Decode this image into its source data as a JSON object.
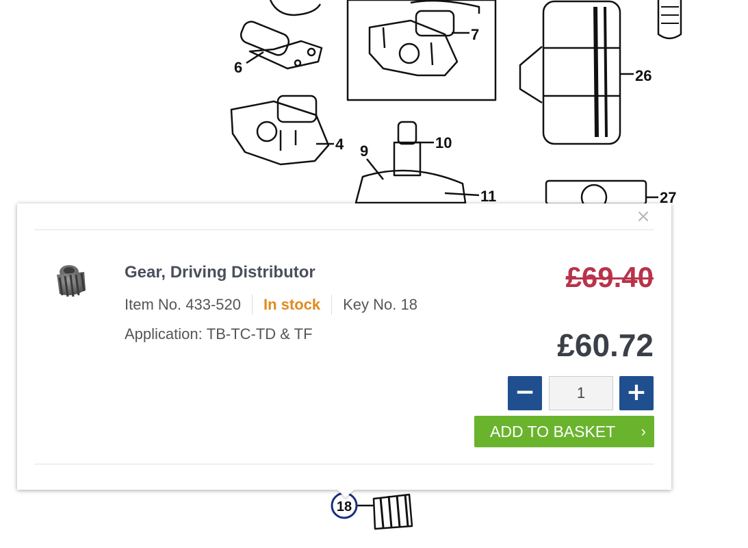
{
  "diagram": {
    "callouts": [
      "6",
      "7",
      "26",
      "4",
      "10",
      "9",
      "11",
      "27",
      "18"
    ]
  },
  "popup": {
    "close_icon": "×",
    "product": {
      "thumbnail_icon": "gear-thumbnail",
      "title": "Gear, Driving Distributor",
      "item_no": "Item No. 433-520",
      "stock_status": "In stock",
      "key_no": "Key No. 18",
      "application_label": "Application:",
      "application_value": "TB-TC-TD & TF"
    },
    "pricing": {
      "old_price": "£69.40",
      "new_price": "£60.72"
    },
    "quantity": {
      "minus_label": "−",
      "value": "1",
      "plus_label": "+"
    },
    "add_to_basket": {
      "label": "ADD TO BASKET",
      "arrow": "›"
    }
  },
  "colors": {
    "stock": "#e08a1e",
    "old_price": "#b8334a",
    "qty_button": "#1f4f8f",
    "add_button": "#6ab42d",
    "callout_ring": "#1a2e7a"
  }
}
